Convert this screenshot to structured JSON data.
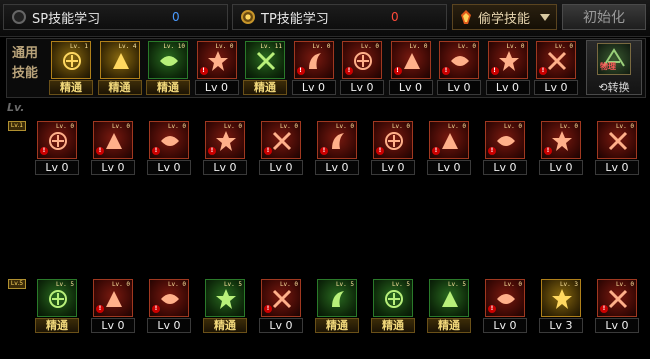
{
  "tabs": {
    "sp": {
      "label": "SP技能学习",
      "value": "0"
    },
    "tp": {
      "label": "TP技能学习",
      "value": "0"
    },
    "steal": {
      "label": "偷学技能"
    },
    "reset": {
      "label": "初始化"
    }
  },
  "common": {
    "label": "通用技能",
    "swap_label": "转换",
    "swap_icon_text": "物理",
    "skills": [
      {
        "icon": "muscle-arm-icon",
        "lv": "Lv. 1",
        "value": "精通",
        "mastered": true,
        "tone": "gold",
        "alert": false
      },
      {
        "icon": "flexing-figure-icon",
        "lv": "Lv. 4",
        "value": "精通",
        "mastered": true,
        "tone": "gold",
        "alert": false
      },
      {
        "icon": "running-figure-icon",
        "lv": "Lv. 10",
        "value": "精通",
        "mastered": true,
        "tone": "green",
        "alert": false
      },
      {
        "icon": "wings-icon",
        "lv": "Lv. 0",
        "value": "Lv 0",
        "mastered": false,
        "tone": "red",
        "alert": true
      },
      {
        "icon": "crosshair-icon",
        "lv": "Lv. 11",
        "value": "精通",
        "mastered": true,
        "tone": "green",
        "alert": false
      },
      {
        "icon": "target-icon",
        "lv": "Lv. 0",
        "value": "Lv 0",
        "mastered": false,
        "tone": "red",
        "alert": true
      },
      {
        "icon": "beast-icon",
        "lv": "Lv. 0",
        "value": "Lv 0",
        "mastered": false,
        "tone": "red",
        "alert": true
      },
      {
        "icon": "leaping-figure-icon",
        "lv": "Lv. 0",
        "value": "Lv 0",
        "mastered": false,
        "tone": "red",
        "alert": true
      },
      {
        "icon": "ring-burst-icon",
        "lv": "Lv. 0",
        "value": "Lv 0",
        "mastered": false,
        "tone": "red",
        "alert": true
      },
      {
        "icon": "armored-figure-icon",
        "lv": "Lv. 0",
        "value": "Lv 0",
        "mastered": false,
        "tone": "red",
        "alert": true
      },
      {
        "icon": "serpent-icon",
        "lv": "Lv. 0",
        "value": "Lv 0",
        "mastered": false,
        "tone": "red",
        "alert": true
      }
    ]
  },
  "lv_marker": "Lv.",
  "row1": {
    "tag": "Lv.1",
    "skills": [
      {
        "icon": "brawler-icon",
        "lv": "Lv. 0",
        "value": "Lv 0",
        "mastered": false,
        "tone": "red",
        "alert": true
      },
      {
        "icon": "claw-slash-icon",
        "lv": "Lv. 0",
        "value": "Lv 0",
        "mastered": false,
        "tone": "red",
        "alert": true
      },
      {
        "icon": "feather-strike-icon",
        "lv": "Lv. 0",
        "value": "Lv 0",
        "mastered": false,
        "tone": "red",
        "alert": true
      },
      {
        "icon": "arrow-thrust-icon",
        "lv": "Lv. 0",
        "value": "Lv 0",
        "mastered": false,
        "tone": "red",
        "alert": true
      },
      {
        "icon": "shield-cross-icon",
        "lv": "Lv. 0",
        "value": "Lv 0",
        "mastered": false,
        "tone": "red",
        "alert": true
      },
      {
        "icon": "dash-figure-icon",
        "lv": "Lv. 0",
        "value": "Lv 0",
        "mastered": false,
        "tone": "red",
        "alert": true
      },
      {
        "icon": "mask-icon",
        "lv": "Lv. 0",
        "value": "Lv 0",
        "mastered": false,
        "tone": "red",
        "alert": true
      },
      {
        "icon": "wind-slash-icon",
        "lv": "Lv. 0",
        "value": "Lv 0",
        "mastered": false,
        "tone": "red",
        "alert": true
      },
      {
        "icon": "dagger-cross-icon",
        "lv": "Lv. 0",
        "value": "Lv 0",
        "mastered": false,
        "tone": "red",
        "alert": true
      },
      {
        "icon": "swirl-icon",
        "lv": "Lv. 0",
        "value": "Lv 0",
        "mastered": false,
        "tone": "red",
        "alert": true
      },
      {
        "icon": "crescent-icon",
        "lv": "Lv. 0",
        "value": "Lv 0",
        "mastered": false,
        "tone": "red",
        "alert": false
      }
    ]
  },
  "row2": {
    "tag": "Lv.5",
    "skills": [
      {
        "icon": "speed-figure-icon",
        "lv": "Lv. 5",
        "value": "精通",
        "mastered": true,
        "tone": "green",
        "alert": false
      },
      {
        "icon": "heart-shield-icon",
        "lv": "Lv. 0",
        "value": "Lv 0",
        "mastered": false,
        "tone": "red",
        "alert": true
      },
      {
        "icon": "rocket-icon",
        "lv": "Lv. 0",
        "value": "Lv 0",
        "mastered": false,
        "tone": "red",
        "alert": true
      },
      {
        "icon": "spiky-burst-icon",
        "lv": "Lv. 5",
        "value": "精通",
        "mastered": true,
        "tone": "green",
        "alert": false
      },
      {
        "icon": "vortex-icon",
        "lv": "Lv. 0",
        "value": "Lv 0",
        "mastered": false,
        "tone": "red",
        "alert": true
      },
      {
        "icon": "star-burst-icon",
        "lv": "Lv. 5",
        "value": "精通",
        "mastered": true,
        "tone": "green",
        "alert": false
      },
      {
        "icon": "explosion-figure-icon",
        "lv": "Lv. 5",
        "value": "精通",
        "mastered": true,
        "tone": "green",
        "alert": false
      },
      {
        "icon": "kick-figure-icon",
        "lv": "Lv. 5",
        "value": "精通",
        "mastered": true,
        "tone": "green",
        "alert": false
      },
      {
        "icon": "fire-burst-icon",
        "lv": "Lv. 0",
        "value": "Lv 0",
        "mastered": false,
        "tone": "red",
        "alert": true
      },
      {
        "icon": "wave-strike-icon",
        "lv": "Lv. 3",
        "value": "Lv 3",
        "mastered": false,
        "tone": "gold",
        "alert": false
      },
      {
        "icon": "fire-figure-icon",
        "lv": "Lv. 0",
        "value": "Lv 0",
        "mastered": false,
        "tone": "red",
        "alert": true
      }
    ]
  }
}
